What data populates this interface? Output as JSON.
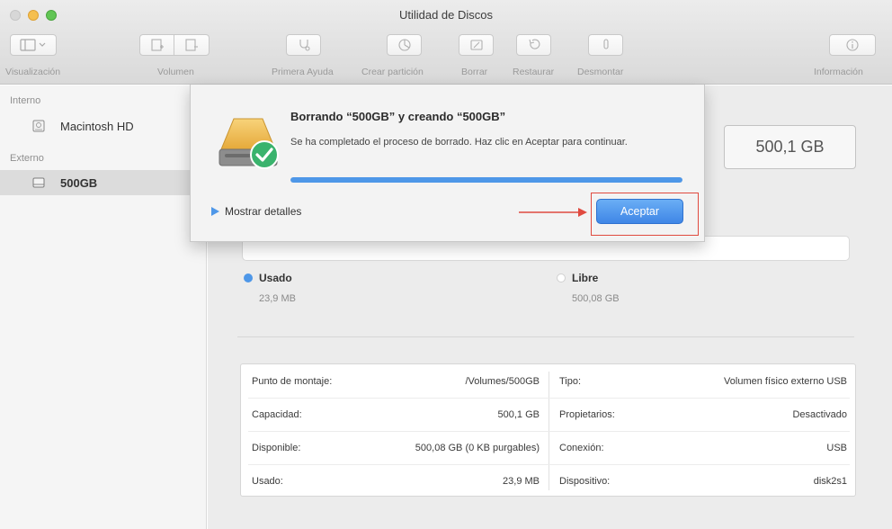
{
  "window": {
    "title": "Utilidad de Discos"
  },
  "toolbar": {
    "visualizacion": "Visualización",
    "volumen": "Volumen",
    "primera_ayuda": "Primera Ayuda",
    "crear_particion": "Crear partición",
    "borrar": "Borrar",
    "restaurar": "Restaurar",
    "desmontar": "Desmontar",
    "informacion": "Información"
  },
  "sidebar": {
    "internal_header": "Interno",
    "internal_disk": "Macintosh HD",
    "external_header": "Externo",
    "external_disk": "500GB"
  },
  "disk": {
    "capacity": "500,1 GB",
    "used_label": "Usado",
    "used_value": "23,9 MB",
    "free_label": "Libre",
    "free_value": "500,08 GB",
    "used_color": "#4e97e8"
  },
  "info": {
    "mount_point_label": "Punto de montaje:",
    "mount_point_value": "/Volumes/500GB",
    "type_label": "Tipo:",
    "type_value": "Volumen físico externo USB",
    "capacity_label": "Capacidad:",
    "capacity_value": "500,1 GB",
    "owners_label": "Propietarios:",
    "owners_value": "Desactivado",
    "available_label": "Disponible:",
    "available_value": "500,08 GB (0 KB purgables)",
    "connection_label": "Conexión:",
    "connection_value": "USB",
    "used_label": "Usado:",
    "used_value": "23,9 MB",
    "device_label": "Dispositivo:",
    "device_value": "disk2s1"
  },
  "dialog": {
    "title": "Borrando “500GB” y creando “500GB”",
    "message": "Se ha completado el proceso de borrado. Haz clic en Aceptar para continuar.",
    "progress": 1.0,
    "details_label": "Mostrar detalles",
    "accept_label": "Aceptar",
    "accent_color": "#4e97e8",
    "highlight_color": "#e04a3f"
  }
}
